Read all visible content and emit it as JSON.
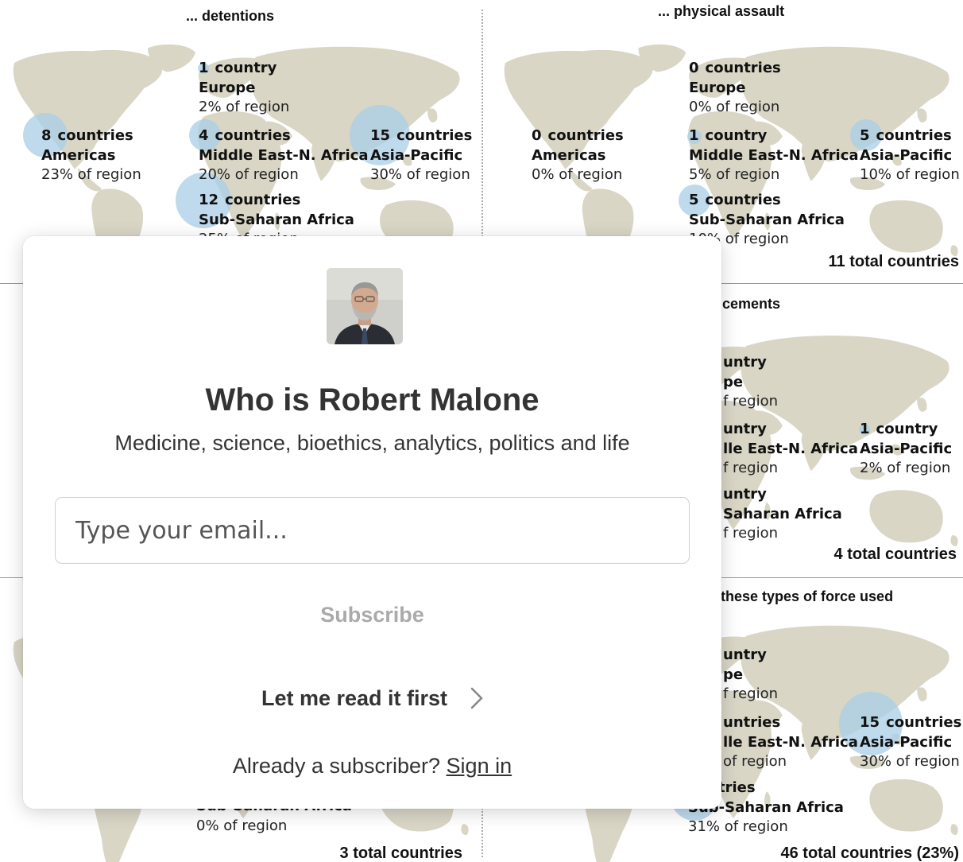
{
  "background": {
    "panels": [
      {
        "title": "... detentions",
        "total": "",
        "stats": [
          {
            "num": "1",
            "unit": "country",
            "region": "Europe",
            "pct": "2% of region"
          },
          {
            "num": "8",
            "unit": "countries",
            "region": "Americas",
            "pct": "23% of region"
          },
          {
            "num": "4",
            "unit": "countries",
            "region": "Middle East-N. Africa",
            "pct": "20% of region"
          },
          {
            "num": "15",
            "unit": "countries",
            "region": "Asia-Pacific",
            "pct": "30% of region"
          },
          {
            "num": "12",
            "unit": "countries",
            "region": "Sub-Saharan Africa",
            "pct": "25% of region"
          }
        ]
      },
      {
        "title": "... physical assault",
        "total": "11 total countries",
        "stats": [
          {
            "num": "0",
            "unit": "countries",
            "region": "Europe",
            "pct": "0% of region"
          },
          {
            "num": "0",
            "unit": "countries",
            "region": "Americas",
            "pct": "0% of region"
          },
          {
            "num": "1",
            "unit": "country",
            "region": "Middle East-N. Africa",
            "pct": "5% of region"
          },
          {
            "num": "5",
            "unit": "countries",
            "region": "Asia-Pacific",
            "pct": "10% of region"
          },
          {
            "num": "5",
            "unit": "countries",
            "region": "Sub-Saharan Africa",
            "pct": "10% of region"
          }
        ]
      },
      {
        "title": "cements",
        "total": "4 total countries",
        "stats": [
          {
            "num": "",
            "unit": "untry",
            "region": "pe",
            "pct": "f region"
          },
          {
            "num": "",
            "unit": "untry",
            "region": "lle East-N. Africa",
            "pct": "f region"
          },
          {
            "num": "1",
            "unit": "country",
            "region": "Asia-Pacific",
            "pct": "2% of region"
          },
          {
            "num": "",
            "unit": "untry",
            "region": "Saharan Africa",
            "pct": "f region"
          }
        ]
      },
      {
        "title": "",
        "total": "3 total countries",
        "stats": [
          {
            "num": "",
            "unit": "",
            "region": "Sub-Saharan Africa",
            "pct": "0% of region"
          }
        ]
      },
      {
        "title": "these types of force used",
        "total": "46 total countries (23%)",
        "stats": [
          {
            "num": "",
            "unit": "untry",
            "region": "pe",
            "pct": "f region"
          },
          {
            "num": "",
            "unit": "untries",
            "region": "lle East-N. Africa",
            "pct": "of region"
          },
          {
            "num": "15",
            "unit": "countries",
            "region": "Asia-Pacific",
            "pct": "30% of region"
          },
          {
            "num": "",
            "unit": "ountries",
            "region": "Sub-Saharan Africa",
            "pct": "31% of region"
          }
        ]
      }
    ]
  },
  "modal": {
    "avatar_icon": "author-avatar",
    "title": "Who is Robert Malone",
    "subtitle": "Medicine, science, bioethics, analytics, politics and life",
    "email_placeholder": "Type your email...",
    "subscribe_label": "Subscribe",
    "read_first_label": "Let me read it first",
    "chevron_icon": "chevron-right-icon",
    "already_text": "Already a subscriber?",
    "sign_in_label": "Sign in"
  },
  "colors": {
    "land": "#d9d6c6",
    "bubble": "#a8cde6",
    "subscribe_text": "#aaaaaa",
    "text": "#333333"
  }
}
